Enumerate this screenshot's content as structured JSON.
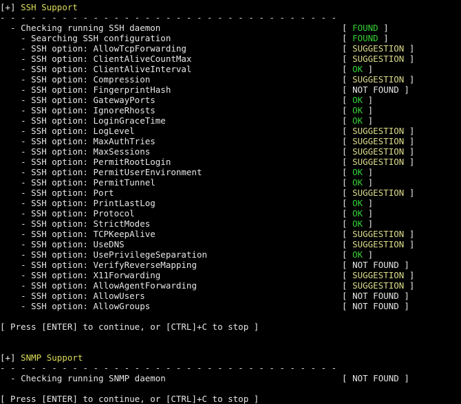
{
  "terminal": {
    "title": "Lynis security audit terminal output",
    "colors": {
      "background": "#000000",
      "default_text": "#e6e6e6",
      "section_header": "#dcdc5a",
      "ok": "#35d135",
      "found": "#35d135",
      "suggestion": "#dcdc8c",
      "not_found": "#e6e6e6"
    }
  },
  "sections": [
    {
      "marker": "[+]",
      "title": "SSH Support",
      "separator": "- - - - - - - - - - - - - - - - - - - - - - - - - - - - - - - - -",
      "rows": [
        {
          "indent": 2,
          "label": "- Checking running SSH daemon",
          "status": "FOUND",
          "kind": "found"
        },
        {
          "indent": 4,
          "label": "- Searching SSH configuration",
          "status": "FOUND",
          "kind": "found"
        },
        {
          "indent": 4,
          "label": "- SSH option: AllowTcpForwarding",
          "status": "SUGGESTION",
          "kind": "sugg"
        },
        {
          "indent": 4,
          "label": "- SSH option: ClientAliveCountMax",
          "status": "SUGGESTION",
          "kind": "sugg"
        },
        {
          "indent": 4,
          "label": "- SSH option: ClientAliveInterval",
          "status": "OK",
          "kind": "ok"
        },
        {
          "indent": 4,
          "label": "- SSH option: Compression",
          "status": "SUGGESTION",
          "kind": "sugg"
        },
        {
          "indent": 4,
          "label": "- SSH option: FingerprintHash",
          "status": "NOT FOUND",
          "kind": "notfnd"
        },
        {
          "indent": 4,
          "label": "- SSH option: GatewayPorts",
          "status": "OK",
          "kind": "ok"
        },
        {
          "indent": 4,
          "label": "- SSH option: IgnoreRhosts",
          "status": "OK",
          "kind": "ok"
        },
        {
          "indent": 4,
          "label": "- SSH option: LoginGraceTime",
          "status": "OK",
          "kind": "ok"
        },
        {
          "indent": 4,
          "label": "- SSH option: LogLevel",
          "status": "SUGGESTION",
          "kind": "sugg"
        },
        {
          "indent": 4,
          "label": "- SSH option: MaxAuthTries",
          "status": "SUGGESTION",
          "kind": "sugg"
        },
        {
          "indent": 4,
          "label": "- SSH option: MaxSessions",
          "status": "SUGGESTION",
          "kind": "sugg"
        },
        {
          "indent": 4,
          "label": "- SSH option: PermitRootLogin",
          "status": "SUGGESTION",
          "kind": "sugg"
        },
        {
          "indent": 4,
          "label": "- SSH option: PermitUserEnvironment",
          "status": "OK",
          "kind": "ok"
        },
        {
          "indent": 4,
          "label": "- SSH option: PermitTunnel",
          "status": "OK",
          "kind": "ok"
        },
        {
          "indent": 4,
          "label": "- SSH option: Port",
          "status": "SUGGESTION",
          "kind": "sugg"
        },
        {
          "indent": 4,
          "label": "- SSH option: PrintLastLog",
          "status": "OK",
          "kind": "ok"
        },
        {
          "indent": 4,
          "label": "- SSH option: Protocol",
          "status": "OK",
          "kind": "ok"
        },
        {
          "indent": 4,
          "label": "- SSH option: StrictModes",
          "status": "OK",
          "kind": "ok"
        },
        {
          "indent": 4,
          "label": "- SSH option: TCPKeepAlive",
          "status": "SUGGESTION",
          "kind": "sugg"
        },
        {
          "indent": 4,
          "label": "- SSH option: UseDNS",
          "status": "SUGGESTION",
          "kind": "sugg"
        },
        {
          "indent": 4,
          "label": "- SSH option: UsePrivilegeSeparation",
          "status": "OK",
          "kind": "ok"
        },
        {
          "indent": 4,
          "label": "- SSH option: VerifyReverseMapping",
          "status": "NOT FOUND",
          "kind": "notfnd"
        },
        {
          "indent": 4,
          "label": "- SSH option: X11Forwarding",
          "status": "SUGGESTION",
          "kind": "sugg"
        },
        {
          "indent": 4,
          "label": "- SSH option: AllowAgentForwarding",
          "status": "SUGGESTION",
          "kind": "sugg"
        },
        {
          "indent": 4,
          "label": "- SSH option: AllowUsers",
          "status": "NOT FOUND",
          "kind": "notfnd"
        },
        {
          "indent": 4,
          "label": "- SSH option: AllowGroups",
          "status": "NOT FOUND",
          "kind": "notfnd"
        }
      ],
      "prompt": "[ Press [ENTER] to continue, or [CTRL]+C to stop ]"
    },
    {
      "marker": "[+]",
      "title": "SNMP Support",
      "separator": "- - - - - - - - - - - - - - - - - - - - - - - - - - - - - - - - -",
      "rows": [
        {
          "indent": 2,
          "label": "- Checking running SNMP daemon",
          "status": "NOT FOUND",
          "kind": "notfnd"
        }
      ],
      "prompt": "[ Press [ENTER] to continue, or [CTRL]+C to stop ]"
    }
  ]
}
